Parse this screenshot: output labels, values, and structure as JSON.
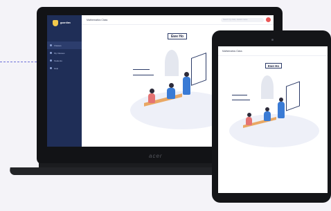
{
  "laptop": {
    "brand": "acer",
    "logo_text": "guardian",
    "topbar_title": "Mathematics Class",
    "search_placeholder": "Search by class, student name",
    "sidebar_items": [
      "Classes",
      "My Classes",
      "Students",
      "Help"
    ],
    "board_title": "Ewe Ho"
  },
  "tablet": {
    "topbar_title": "Mathematics Class",
    "board_title": "Ewe Ho"
  },
  "colors": {
    "sidebar": "#1f2e57",
    "accent_red": "#eb5757",
    "shirt_blue": "#3a7bd5",
    "table": "#e9a864"
  }
}
